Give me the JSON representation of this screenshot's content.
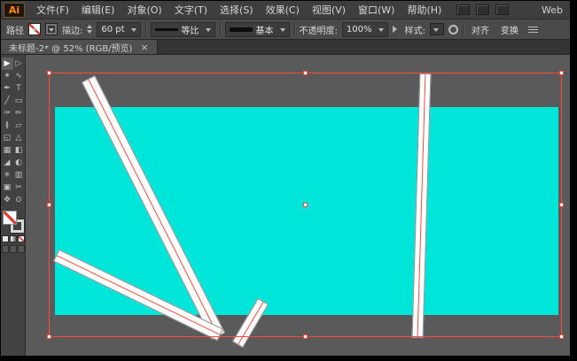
{
  "colors": {
    "cyan": "#00e5da",
    "selred": "#ff4a3d"
  },
  "app_logo": "Ai",
  "menubar": {
    "items": [
      "文件(F)",
      "编辑(E)",
      "对象(O)",
      "文字(T)",
      "选择(S)",
      "效果(C)",
      "视图(V)",
      "窗口(W)",
      "帮助(H)"
    ],
    "workspace": "Web"
  },
  "controlbar": {
    "object_type": "路径",
    "stroke_label": "描边:",
    "stroke_value": "60 pt",
    "profile_value": "等比",
    "brush_value": "基本",
    "opacity_label": "不透明度:",
    "opacity_value": "100%",
    "style_label": "样式:",
    "align_button": "对齐",
    "transform_button": "变换"
  },
  "tabbar": {
    "title": "未标题-2* @ 52% (RGB/预览)",
    "close": "×"
  },
  "toolbar": {
    "tools": [
      {
        "name": "selection-tool",
        "glyph": "▶"
      },
      {
        "name": "direct-selection-tool",
        "glyph": "▷"
      },
      {
        "name": "magic-wand-tool",
        "glyph": "✶"
      },
      {
        "name": "lasso-tool",
        "glyph": "∿"
      },
      {
        "name": "pen-tool",
        "glyph": "✒"
      },
      {
        "name": "type-tool",
        "glyph": "T"
      },
      {
        "name": "line-segment-tool",
        "glyph": "╱"
      },
      {
        "name": "rectangle-tool",
        "glyph": "▭"
      },
      {
        "name": "paintbrush-tool",
        "glyph": "✑"
      },
      {
        "name": "pencil-tool",
        "glyph": "✏"
      },
      {
        "name": "width-tool",
        "glyph": "≬"
      },
      {
        "name": "free-transform-tool",
        "glyph": "▱"
      },
      {
        "name": "shape-builder-tool",
        "glyph": "◱"
      },
      {
        "name": "perspective-grid-tool",
        "glyph": "△"
      },
      {
        "name": "mesh-tool",
        "glyph": "▦"
      },
      {
        "name": "gradient-tool",
        "glyph": "◧"
      },
      {
        "name": "eyedropper-tool",
        "glyph": "◢"
      },
      {
        "name": "blend-tool",
        "glyph": "◐"
      },
      {
        "name": "symbol-sprayer-tool",
        "glyph": "✳"
      },
      {
        "name": "column-graph-tool",
        "glyph": "▥"
      },
      {
        "name": "artboard-tool",
        "glyph": "▣"
      },
      {
        "name": "slice-tool",
        "glyph": "✂"
      },
      {
        "name": "hand-tool",
        "glyph": "✥"
      },
      {
        "name": "zoom-tool",
        "glyph": "⊙"
      }
    ]
  },
  "canvas": {
    "zoom": "52%",
    "artboard_color": "#00e5da",
    "selection_color": "#ff4a3d"
  }
}
